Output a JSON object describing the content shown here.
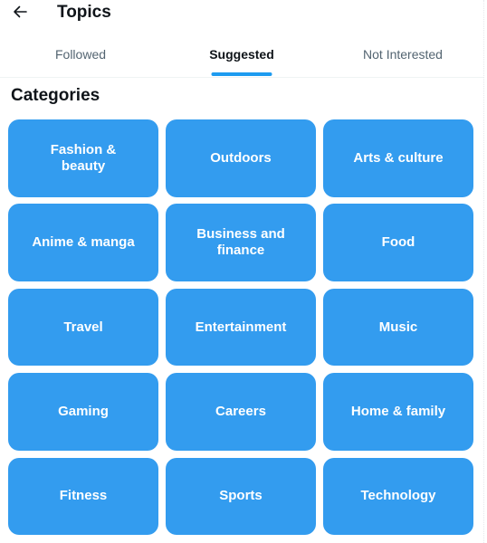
{
  "header": {
    "back_icon": "arrow-left-icon",
    "title": "Topics"
  },
  "tabs": [
    {
      "label": "Followed",
      "active": false
    },
    {
      "label": "Suggested",
      "active": true
    },
    {
      "label": "Not Interested",
      "active": false
    }
  ],
  "section": {
    "title": "Categories"
  },
  "colors": {
    "accent": "#1d9bf0",
    "tile": "#339cef",
    "text": "#0f1419",
    "muted": "#536471"
  },
  "categories": [
    "Fashion & beauty",
    "Outdoors",
    "Arts & culture",
    "Anime & manga",
    "Business and finance",
    "Food",
    "Travel",
    "Entertainment",
    "Music",
    "Gaming",
    "Careers",
    "Home & family",
    "Fitness",
    "Sports",
    "Technology"
  ]
}
